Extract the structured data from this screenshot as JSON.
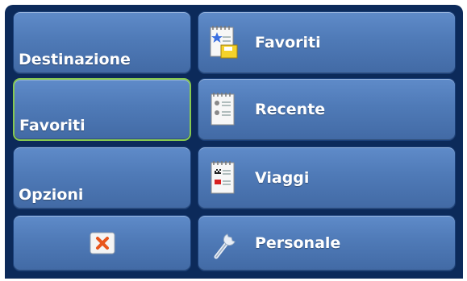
{
  "left_menu": {
    "destinazione": "Destinazione",
    "favoriti": "Favoriti",
    "opzioni": "Opzioni",
    "close_icon": "close-x-icon"
  },
  "right_menu": {
    "favoriti": {
      "label": "Favoriti",
      "icon": "favorites-notepad-icon"
    },
    "recente": {
      "label": "Recente",
      "icon": "recent-notepad-icon"
    },
    "viaggi": {
      "label": "Viaggi",
      "icon": "trips-notepad-icon"
    },
    "personale": {
      "label": "Personale",
      "icon": "wrench-icon"
    }
  },
  "colors": {
    "background": "#0c2a5a",
    "button": "#4f7ab7",
    "selected_border": "#86c94f",
    "close_x": "#e8551c"
  }
}
